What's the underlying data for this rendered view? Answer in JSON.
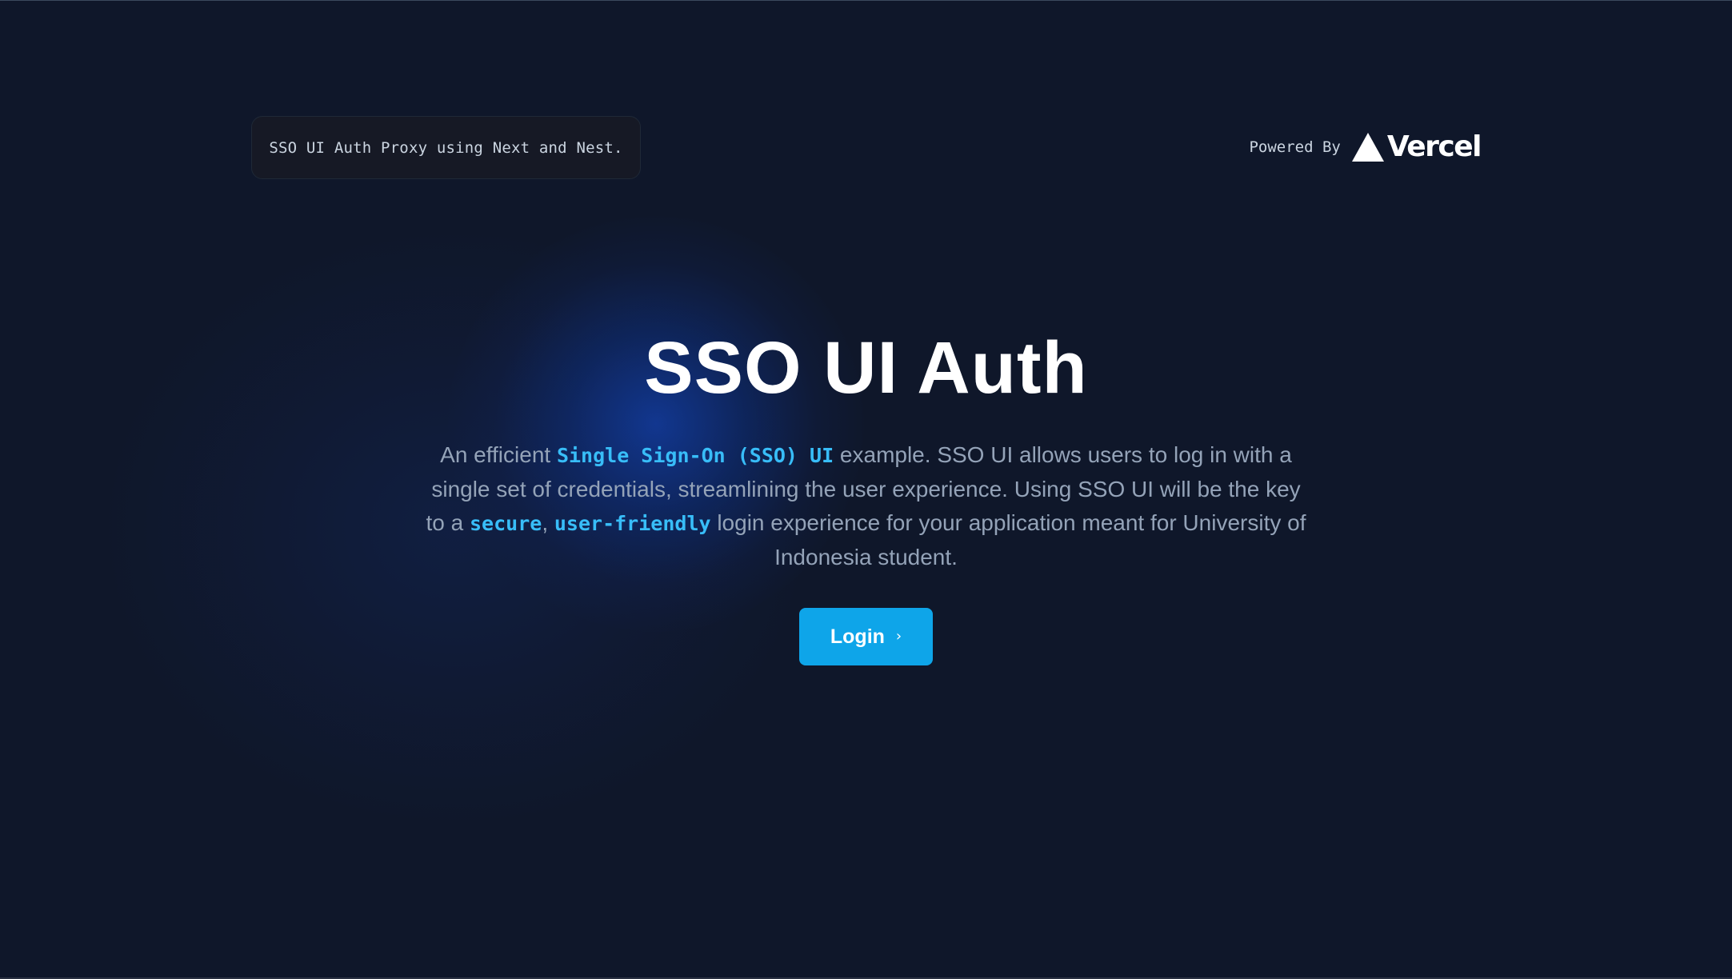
{
  "header": {
    "tagline": "SSO UI Auth Proxy using Next and Nest.",
    "powered_by_label": "Powered By",
    "vercel_wordmark": "Vercel",
    "vercel_icon": "vercel-triangle-icon"
  },
  "hero": {
    "title": "SSO UI Auth",
    "desc_part1": "An efficient ",
    "highlight_sso": "Single Sign-On (SSO) UI",
    "desc_part2": " example. SSO UI allows users to log in with a single set of credentials, streamlining the user experience. Using SSO UI will be the key to a ",
    "highlight_secure": "secure",
    "desc_comma": ", ",
    "highlight_friendly": "user-friendly",
    "desc_part3": " login experience for your application meant for University of Indonesia student."
  },
  "login_button": {
    "label": "Login",
    "icon": "chevron-right-icon"
  },
  "colors": {
    "background": "#0f172a",
    "accent": "#38bdf8",
    "button": "#0ea5e9",
    "text_muted": "#94a3b8"
  }
}
